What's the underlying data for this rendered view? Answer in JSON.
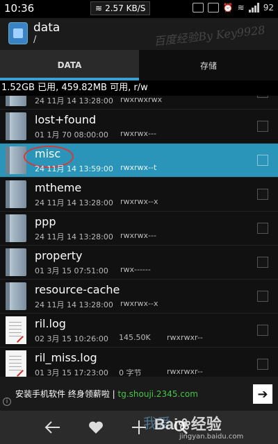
{
  "status": {
    "time": "10:36",
    "speed": "2.57 KB/S",
    "battery": "92"
  },
  "header": {
    "title": "data",
    "path": "/",
    "watermark": "百度经验By Key9928"
  },
  "tabs": [
    {
      "label": "DATA",
      "active": true
    },
    {
      "label": "存储",
      "active": false
    }
  ],
  "info": "1.52GB 已用, 459.82MB 可用, r/w",
  "list": [
    {
      "name": "",
      "date": "24 11月 14 13:28:00",
      "size": "",
      "perm": "rwxrwxrwx",
      "type": "folder"
    },
    {
      "name": "lost+found",
      "date": "01 1月 70 08:00:00",
      "size": "",
      "perm": "rwxrwx---",
      "type": "folder"
    },
    {
      "name": "misc",
      "date": "24 11月 14 13:59:00",
      "size": "",
      "perm": "rwxrwx--t",
      "type": "folder",
      "selected": true
    },
    {
      "name": "mtheme",
      "date": "24 11月 14 13:28:00",
      "size": "",
      "perm": "rwxrwx--x",
      "type": "folder"
    },
    {
      "name": "ppp",
      "date": "24 11月 14 13:28:00",
      "size": "",
      "perm": "rwxrwx---",
      "type": "folder"
    },
    {
      "name": "property",
      "date": "01 3月 15 07:51:00",
      "size": "",
      "perm": "rwx------",
      "type": "folder"
    },
    {
      "name": "resource-cache",
      "date": "24 11月 14 13:28:00",
      "size": "",
      "perm": "rwxrwx--x",
      "type": "folder"
    },
    {
      "name": "ril.log",
      "date": "02 3月 15 10:26:00",
      "size": "145.50K",
      "perm": "rwxrwxr--",
      "type": "file"
    },
    {
      "name": "ril_miss.log",
      "date": "01 3月 15 17:23:00",
      "size": "0 字节",
      "perm": "rwxrwxr--",
      "type": "file"
    }
  ],
  "banner": {
    "text": "安装手机软件 终身领薪啦 | ",
    "url": "tg.shouji.2345.com",
    "info_icon": "i",
    "go_icon": "➔"
  },
  "bottomnav": {
    "watermark_logo": "Bai",
    "watermark_logo2": "经验",
    "watermark_cn": "我爱",
    "watermark_sub": "jingyan.baidu.com"
  },
  "colors": {
    "accent": "#3aa0cf",
    "selected_row": "#2a95b8",
    "banner_url": "#49c449"
  }
}
